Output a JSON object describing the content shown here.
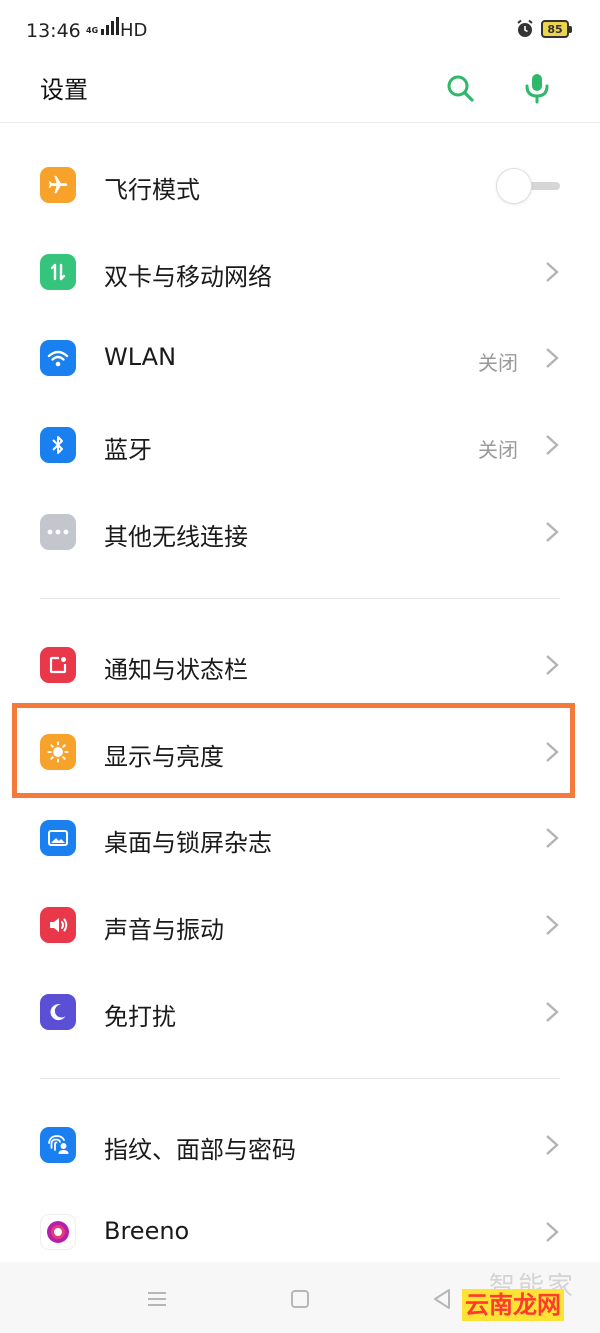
{
  "status_bar": {
    "time": "13:46",
    "network": "4G",
    "hd": "HD",
    "battery": "85"
  },
  "header": {
    "title": "设置"
  },
  "colors": {
    "accent": "#2fb86a",
    "highlight": "#f47a3c"
  },
  "sections": [
    {
      "items": [
        {
          "label": "飞行模式",
          "icon": "airplane-icon",
          "icon_color": "#f7a32b",
          "toggle": false
        },
        {
          "label": "双卡与移动网络",
          "icon": "dual-sim-icon",
          "icon_color": "#34c47c"
        },
        {
          "label": "WLAN",
          "icon": "wifi-icon",
          "icon_color": "#1a80f0",
          "value": "关闭"
        },
        {
          "label": "蓝牙",
          "icon": "bluetooth-icon",
          "icon_color": "#1a80f0",
          "value": "关闭"
        },
        {
          "label": "其他无线连接",
          "icon": "more-icon",
          "icon_color": "#c3c6cc"
        }
      ]
    },
    {
      "items": [
        {
          "label": "通知与状态栏",
          "icon": "notification-icon",
          "icon_color": "#e8384a"
        },
        {
          "label": "显示与亮度",
          "icon": "brightness-icon",
          "icon_color": "#f7a32b",
          "highlighted": true
        },
        {
          "label": "桌面与锁屏杂志",
          "icon": "wallpaper-icon",
          "icon_color": "#1a80f0"
        },
        {
          "label": "声音与振动",
          "icon": "sound-icon",
          "icon_color": "#e8384a"
        },
        {
          "label": "免打扰",
          "icon": "moon-icon",
          "icon_color": "#5b4fd6"
        }
      ]
    },
    {
      "items": [
        {
          "label": "指纹、面部与密码",
          "icon": "fingerprint-face-icon",
          "icon_color": "#1a80f0"
        },
        {
          "label": "Breeno",
          "icon": "breeno-icon",
          "icon_color": "#b81fa8"
        }
      ]
    }
  ],
  "watermark": {
    "text1": "智能家",
    "text2": "云南龙网"
  }
}
